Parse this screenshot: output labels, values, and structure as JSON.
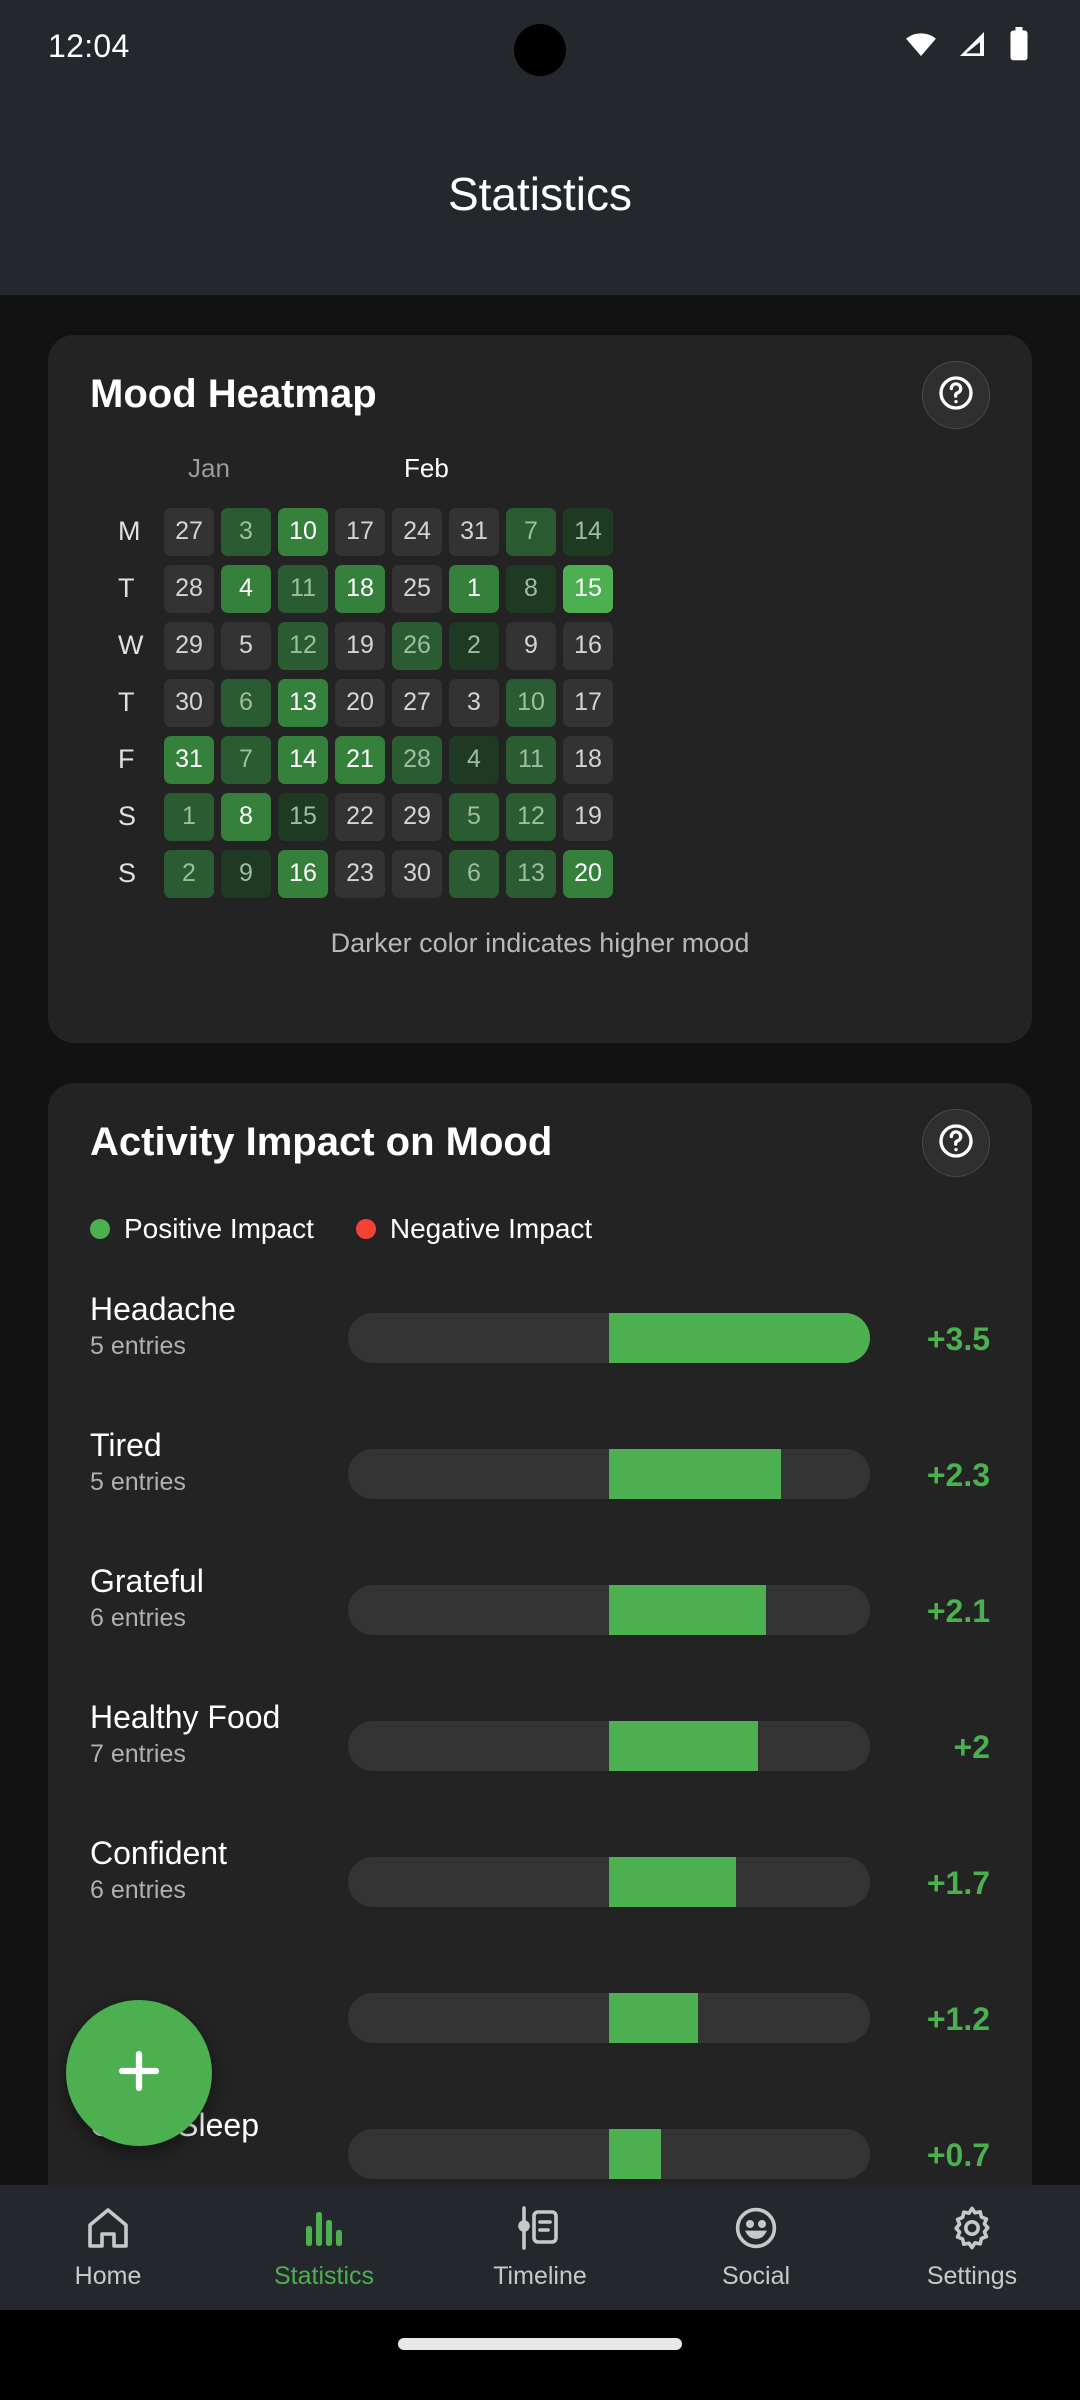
{
  "status_bar": {
    "time": "12:04",
    "icons": [
      "wifi-icon",
      "cellular-icon",
      "battery-icon"
    ]
  },
  "app_bar": {
    "title": "Statistics"
  },
  "colors": {
    "accent_green": "#4CAF50",
    "negative_red": "#F44336",
    "card_bg": "#232323",
    "page_bg": "#121212",
    "bar_track": "#343434"
  },
  "heatmap_card": {
    "title": "Mood Heatmap",
    "help_icon": "help-circle-icon",
    "months": [
      {
        "label": "Jan",
        "muted": true
      },
      {
        "label": "Feb",
        "muted": false
      }
    ],
    "day_labels": [
      "M",
      "T",
      "W",
      "T",
      "F",
      "S",
      "S"
    ],
    "caption": "Darker color indicates higher mood"
  },
  "activity_card": {
    "title": "Activity Impact on Mood",
    "help_icon": "help-circle-icon",
    "legend": [
      {
        "label": "Positive Impact",
        "color": "#4CAF50"
      },
      {
        "label": "Negative Impact",
        "color": "#F44336"
      }
    ]
  },
  "fab": {
    "icon": "plus-icon"
  },
  "bottom_nav": {
    "items": [
      {
        "label": "Home",
        "icon": "home-icon",
        "active": false
      },
      {
        "label": "Statistics",
        "icon": "bar-chart-icon",
        "active": true
      },
      {
        "label": "Timeline",
        "icon": "timeline-icon",
        "active": false
      },
      {
        "label": "Social",
        "icon": "smiley-icon",
        "active": false
      },
      {
        "label": "Settings",
        "icon": "gear-icon",
        "active": false
      }
    ]
  },
  "chart_data": [
    {
      "type": "heatmap",
      "title": "Mood Heatmap",
      "xlabel": "",
      "ylabel": "",
      "grid": false,
      "legend": "Darker color indicates higher mood",
      "row_labels": [
        "M",
        "T",
        "W",
        "T",
        "F",
        "S",
        "S"
      ],
      "column_labels": [
        "Jan",
        "",
        "",
        "",
        "",
        "Feb",
        "",
        ""
      ],
      "levels": {
        "0": "#333333",
        "1": "#1e3a22",
        "2": "#2b5c31",
        "3": "#35813c",
        "4": "#4CAF50"
      },
      "cells": [
        [
          {
            "day": "27",
            "level": 0
          },
          {
            "day": "3",
            "level": 2
          },
          {
            "day": "10",
            "level": 3
          },
          {
            "day": "17",
            "level": 0
          },
          {
            "day": "24",
            "level": 0
          },
          {
            "day": "31",
            "level": 0
          },
          {
            "day": "7",
            "level": 2
          },
          {
            "day": "14",
            "level": 1
          }
        ],
        [
          {
            "day": "28",
            "level": 0
          },
          {
            "day": "4",
            "level": 3
          },
          {
            "day": "11",
            "level": 2
          },
          {
            "day": "18",
            "level": 3
          },
          {
            "day": "25",
            "level": 0
          },
          {
            "day": "1",
            "level": 3
          },
          {
            "day": "8",
            "level": 1
          },
          {
            "day": "15",
            "level": 4
          }
        ],
        [
          {
            "day": "29",
            "level": 0
          },
          {
            "day": "5",
            "level": 0
          },
          {
            "day": "12",
            "level": 2
          },
          {
            "day": "19",
            "level": 0
          },
          {
            "day": "26",
            "level": 2
          },
          {
            "day": "2",
            "level": 1
          },
          {
            "day": "9",
            "level": 0
          },
          {
            "day": "16",
            "level": 0
          }
        ],
        [
          {
            "day": "30",
            "level": 0
          },
          {
            "day": "6",
            "level": 2
          },
          {
            "day": "13",
            "level": 3
          },
          {
            "day": "20",
            "level": 0
          },
          {
            "day": "27",
            "level": 0
          },
          {
            "day": "3",
            "level": 0
          },
          {
            "day": "10",
            "level": 2
          },
          {
            "day": "17",
            "level": 0
          }
        ],
        [
          {
            "day": "31",
            "level": 3
          },
          {
            "day": "7",
            "level": 2
          },
          {
            "day": "14",
            "level": 3
          },
          {
            "day": "21",
            "level": 3
          },
          {
            "day": "28",
            "level": 2
          },
          {
            "day": "4",
            "level": 1
          },
          {
            "day": "11",
            "level": 2
          },
          {
            "day": "18",
            "level": 0
          }
        ],
        [
          {
            "day": "1",
            "level": 2
          },
          {
            "day": "8",
            "level": 3
          },
          {
            "day": "15",
            "level": 1
          },
          {
            "day": "22",
            "level": 0
          },
          {
            "day": "29",
            "level": 0
          },
          {
            "day": "5",
            "level": 2
          },
          {
            "day": "12",
            "level": 2
          },
          {
            "day": "19",
            "level": 0
          }
        ],
        [
          {
            "day": "2",
            "level": 2
          },
          {
            "day": "9",
            "level": 1
          },
          {
            "day": "16",
            "level": 3
          },
          {
            "day": "23",
            "level": 0
          },
          {
            "day": "30",
            "level": 0
          },
          {
            "day": "6",
            "level": 2
          },
          {
            "day": "13",
            "level": 2
          },
          {
            "day": "20",
            "level": 3
          }
        ]
      ]
    },
    {
      "type": "bar",
      "title": "Activity Impact on Mood",
      "orientation": "horizontal",
      "xlabel": "",
      "ylabel": "",
      "grid": false,
      "legend_position": "top-left",
      "series": [
        {
          "name": "Positive Impact",
          "color": "#4CAF50"
        },
        {
          "name": "Negative Impact",
          "color": "#F44336"
        }
      ],
      "xlim": [
        -3.5,
        3.5
      ],
      "categories": [
        "Headache",
        "Tired",
        "Grateful",
        "Healthy Food",
        "Confident",
        "",
        "Good Sleep"
      ],
      "values": [
        3.5,
        2.3,
        2.1,
        2.0,
        1.7,
        1.2,
        0.7
      ],
      "rows": [
        {
          "name": "Headache",
          "entries": "5 entries",
          "value": 3.5,
          "value_label": "+3.5",
          "positive": true,
          "label_hidden": false
        },
        {
          "name": "Tired",
          "entries": "5 entries",
          "value": 2.3,
          "value_label": "+2.3",
          "positive": true,
          "label_hidden": false
        },
        {
          "name": "Grateful",
          "entries": "6 entries",
          "value": 2.1,
          "value_label": "+2.1",
          "positive": true,
          "label_hidden": false
        },
        {
          "name": "Healthy Food",
          "entries": "7 entries",
          "value": 2.0,
          "value_label": "+2",
          "positive": true,
          "label_hidden": false
        },
        {
          "name": "Confident",
          "entries": "6 entries",
          "value": 1.7,
          "value_label": "+1.7",
          "positive": true,
          "label_hidden": false
        },
        {
          "name": "",
          "entries": "",
          "value": 1.2,
          "value_label": "+1.2",
          "positive": true,
          "label_hidden": true
        },
        {
          "name": "Good Sleep",
          "entries": "",
          "value": 0.7,
          "value_label": "+0.7",
          "positive": true,
          "label_hidden": false
        }
      ]
    }
  ]
}
